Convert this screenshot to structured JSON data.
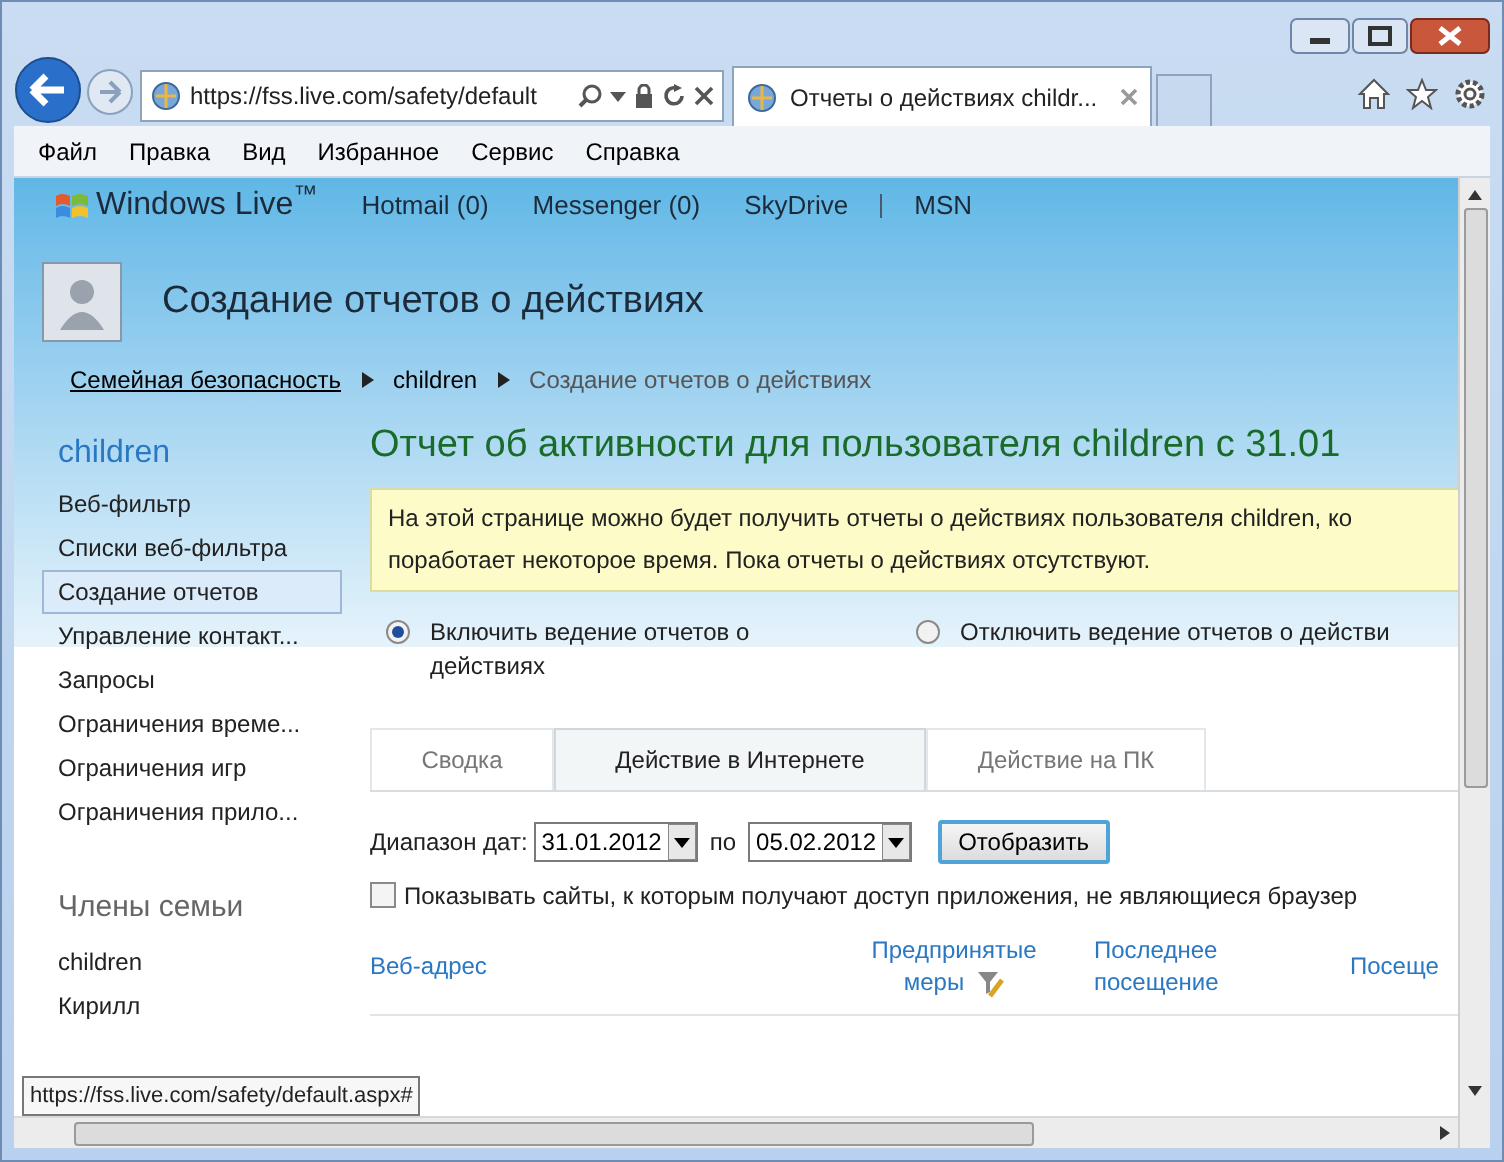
{
  "browser": {
    "address": "https://fss.live.com/safety/default",
    "tabs": [
      {
        "label": "Отчеты о действиях childr...",
        "selected": true
      }
    ],
    "menu": [
      "Файл",
      "Правка",
      "Вид",
      "Избранное",
      "Сервис",
      "Справка"
    ]
  },
  "site_nav": {
    "brand": "Windows Live$^{™}$",
    "links": [
      "Hotmail (0)",
      "Messenger (0)",
      "SkyDrive",
      "MSN"
    ]
  },
  "page_title": "Создание отчетов о действиях",
  "breadcrumbs": [
    {
      "label": "Семейная безопасность",
      "kind": "link"
    },
    {
      "label": "children",
      "kind": "current"
    },
    {
      "label": "Создание отчетов о действиях",
      "kind": "plain"
    }
  ],
  "sidebar": {
    "user": "children",
    "items": [
      {
        "label": "Веб-фильтр",
        "selected": false
      },
      {
        "label": "Списки веб-фильтра",
        "selected": false
      },
      {
        "label": "Создание отчетов",
        "selected": true
      },
      {
        "label": "Управление контакт...",
        "selected": false
      },
      {
        "label": "Запросы",
        "selected": false
      },
      {
        "label": "Ограничения време...",
        "selected": false
      },
      {
        "label": "Ограничения игр",
        "selected": false
      },
      {
        "label": "Ограничения прило...",
        "selected": false
      }
    ],
    "family_heading": "Члены семьи",
    "members": [
      "children",
      "Кирилл"
    ]
  },
  "main": {
    "heading": "Отчет об активности для пользователя children с 31.01",
    "notice": [
      "На этой странице можно будет получить отчеты о действиях пользователя children, ко",
      "поработает некоторое время. Пока отчеты о действиях отсутствуют."
    ],
    "radios": [
      {
        "label": "Включить ведение отчетов о действиях",
        "selected": true
      },
      {
        "label": "Отключить ведение отчетов о действи",
        "selected": false
      }
    ],
    "tabs": [
      {
        "label": "Сводка",
        "selected": false
      },
      {
        "label": "Действие в Интернете",
        "selected": true
      },
      {
        "label": "Действие на ПК",
        "selected": false
      }
    ],
    "date_label": "Диапазон дат:",
    "date_from": "31.01.2012",
    "date_sep": "по",
    "date_to": "05.02.2012",
    "show_button": "Отобразить",
    "checkbox": {
      "label": "Показывать сайты, к которым получают доступ приложения, не являющиеся браузер",
      "checked": false
    },
    "columns": [
      {
        "label": "Веб-адрес",
        "filter": false
      },
      {
        "label": "Предпринятые меры",
        "filter": true
      },
      {
        "label": "Последнее посещение",
        "filter": false
      },
      {
        "label": "Посеще",
        "filter": false
      }
    ]
  },
  "status_tooltip": "https://fss.live.com/safety/default.aspx#"
}
